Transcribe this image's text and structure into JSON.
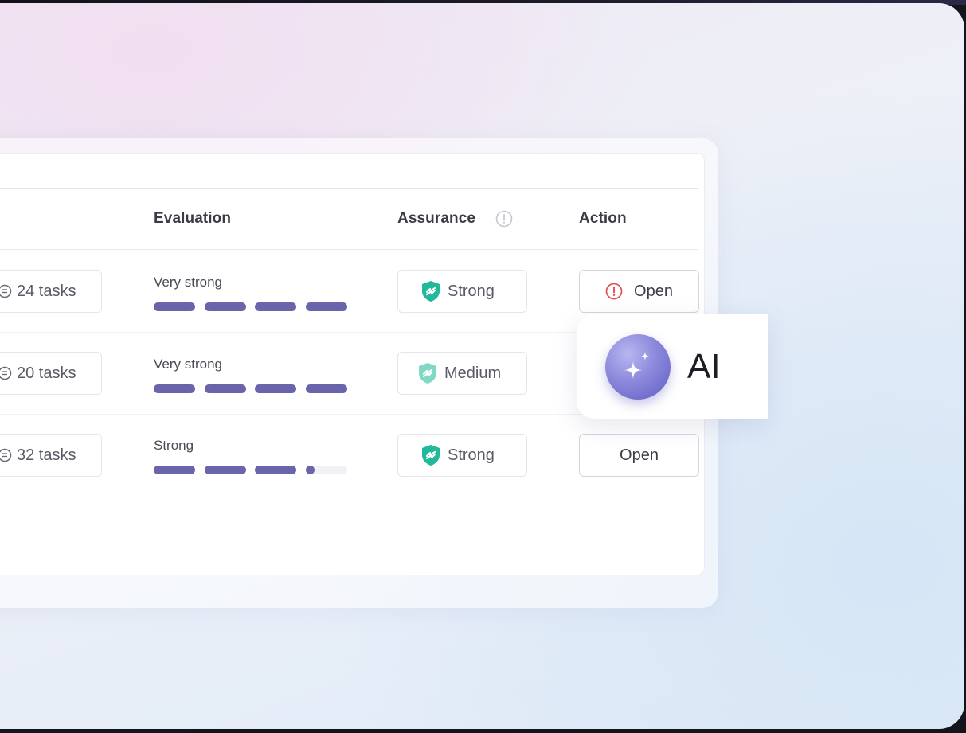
{
  "table": {
    "columns": {
      "evaluation": "Evaluation",
      "assurance": "Assurance",
      "action": "Action"
    },
    "rows": [
      {
        "tasks": "24 tasks",
        "evaluation_label": "Very strong",
        "evaluation_level": 4,
        "assurance": "Strong",
        "assurance_color": "#22b89a",
        "action": "Open",
        "action_alert": true
      },
      {
        "tasks": "20 tasks",
        "evaluation_label": "Very strong",
        "evaluation_level": 4,
        "assurance": "Medium",
        "assurance_color": "#7fd9c4",
        "action": "",
        "action_alert": false
      },
      {
        "tasks": "32 tasks",
        "evaluation_label": "Strong",
        "evaluation_level": 3.2,
        "assurance": "Strong",
        "assurance_color": "#22b89a",
        "action": "Open",
        "action_alert": false
      }
    ]
  },
  "ai_popover": {
    "label": "AI",
    "icon": "sparkle-icon"
  },
  "colors": {
    "evaluation_fill": "#6a65ab",
    "alert": "#e0504e",
    "accent_ai": "#6f6cc8"
  },
  "icons": {
    "tasks": "tasks-list-icon",
    "info": "info-icon",
    "assurance": "shield-icon",
    "alert": "alert-circle-icon"
  }
}
